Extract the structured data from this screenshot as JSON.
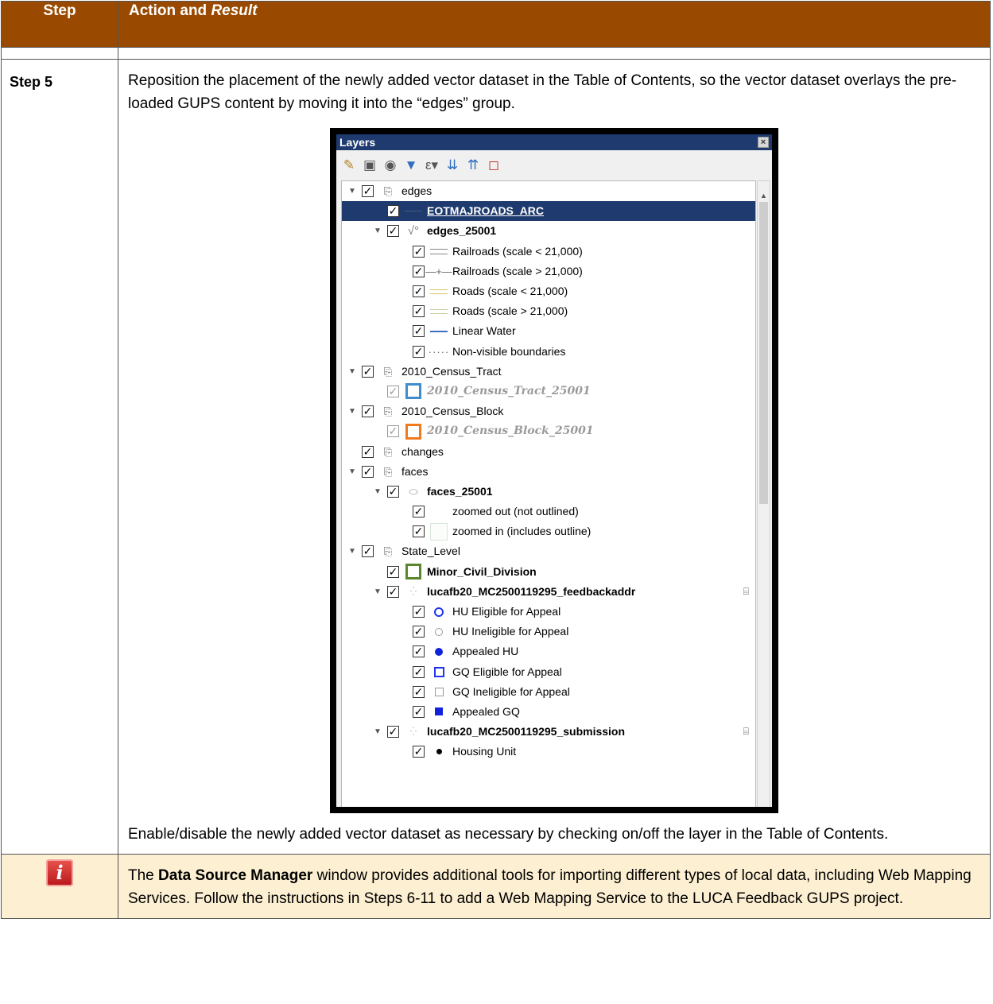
{
  "header": {
    "col1": "Step",
    "col2_plain": "Action and ",
    "col2_italic": "Result"
  },
  "step": {
    "label": "Step 5",
    "para1": "Reposition the placement of the newly added vector dataset in the Table of Contents, so the vector dataset overlays the pre-loaded GUPS content by moving it into the “edges” group.",
    "para2": "Enable/disable the newly added vector dataset as necessary by checking on/off the layer in the Table of Contents."
  },
  "layers_panel": {
    "title": "Layers",
    "items": [
      {
        "label": "edges",
        "indent": 0,
        "arrow": true,
        "sym": "group",
        "style": ""
      },
      {
        "label": "EOTMAJROADS_ARC",
        "indent": 1,
        "arrow": false,
        "sym": "line-dark",
        "style": "u",
        "selected": true
      },
      {
        "label": "edges_25001",
        "indent": 1,
        "arrow": true,
        "sym": "vline",
        "style": "b"
      },
      {
        "label": "Railroads (scale < 21,000)",
        "indent": 2,
        "arrow": false,
        "sym": "rail1",
        "style": ""
      },
      {
        "label": "Railroads (scale > 21,000)",
        "indent": 2,
        "arrow": false,
        "sym": "rail2",
        "style": ""
      },
      {
        "label": "Roads (scale < 21,000)",
        "indent": 2,
        "arrow": false,
        "sym": "road1",
        "style": ""
      },
      {
        "label": "Roads (scale > 21,000)",
        "indent": 2,
        "arrow": false,
        "sym": "road2",
        "style": ""
      },
      {
        "label": "Linear Water",
        "indent": 2,
        "arrow": false,
        "sym": "water",
        "style": ""
      },
      {
        "label": "Non-visible boundaries",
        "indent": 2,
        "arrow": false,
        "sym": "dashed",
        "style": ""
      },
      {
        "label": "2010_Census_Tract",
        "indent": 0,
        "arrow": true,
        "sym": "group",
        "style": ""
      },
      {
        "label": "2010_Census_Tract_25001",
        "indent": 1,
        "arrow": false,
        "sym": "sq-blue",
        "style": "gi",
        "dim": true
      },
      {
        "label": "2010_Census_Block",
        "indent": 0,
        "arrow": true,
        "sym": "group",
        "style": ""
      },
      {
        "label": "2010_Census_Block_25001",
        "indent": 1,
        "arrow": false,
        "sym": "sq-orange",
        "style": "gi",
        "dim": true
      },
      {
        "label": "changes",
        "indent": 0,
        "arrow": false,
        "sym": "group",
        "style": ""
      },
      {
        "label": "faces",
        "indent": 0,
        "arrow": true,
        "sym": "group",
        "style": ""
      },
      {
        "label": "faces_25001",
        "indent": 1,
        "arrow": true,
        "sym": "poly",
        "style": "b"
      },
      {
        "label": "zoomed out (not outlined)",
        "indent": 2,
        "arrow": false,
        "sym": "blank",
        "style": ""
      },
      {
        "label": "zoomed in (includes outline)",
        "indent": 2,
        "arrow": false,
        "sym": "sq-light",
        "style": ""
      },
      {
        "label": "State_Level",
        "indent": 0,
        "arrow": true,
        "sym": "group",
        "style": ""
      },
      {
        "label": "Minor_Civil_Division",
        "indent": 1,
        "arrow": false,
        "sym": "sq-green",
        "style": "b"
      },
      {
        "label": "lucafb20_MC2500119295_feedbackaddr",
        "indent": 1,
        "arrow": true,
        "sym": "dots",
        "style": "b",
        "layer_icon": true
      },
      {
        "label": "HU Eligible for Appeal",
        "indent": 2,
        "arrow": false,
        "sym": "circ-blue",
        "style": ""
      },
      {
        "label": "HU Ineligible for Appeal",
        "indent": 2,
        "arrow": false,
        "sym": "circ-gray",
        "style": ""
      },
      {
        "label": "Appealed HU",
        "indent": 2,
        "arrow": false,
        "sym": "dot-blue",
        "style": ""
      },
      {
        "label": "GQ Eligible for Appeal",
        "indent": 2,
        "arrow": false,
        "sym": "sqo-blue",
        "style": ""
      },
      {
        "label": "GQ Ineligible for Appeal",
        "indent": 2,
        "arrow": false,
        "sym": "sqo-gray",
        "style": ""
      },
      {
        "label": "Appealed GQ",
        "indent": 2,
        "arrow": false,
        "sym": "sqf-blue",
        "style": ""
      },
      {
        "label": "lucafb20_MC2500119295_submission",
        "indent": 1,
        "arrow": true,
        "sym": "dots",
        "style": "b",
        "layer_icon": true
      },
      {
        "label": "Housing Unit",
        "indent": 2,
        "arrow": false,
        "sym": "dot-black",
        "style": ""
      }
    ]
  },
  "note": {
    "pre": "The ",
    "bold": "Data Source Manager",
    "post": " window provides additional tools for importing different types of local data, including Web Mapping Services. Follow the instructions in Steps 6-11 to add a Web Mapping Service to the LUCA Feedback GUPS project.",
    "icon": "info-icon"
  },
  "colors": {
    "header_bg": "#9a4a00",
    "note_bg": "#fcefd2",
    "selection": "#1f3a6e"
  }
}
